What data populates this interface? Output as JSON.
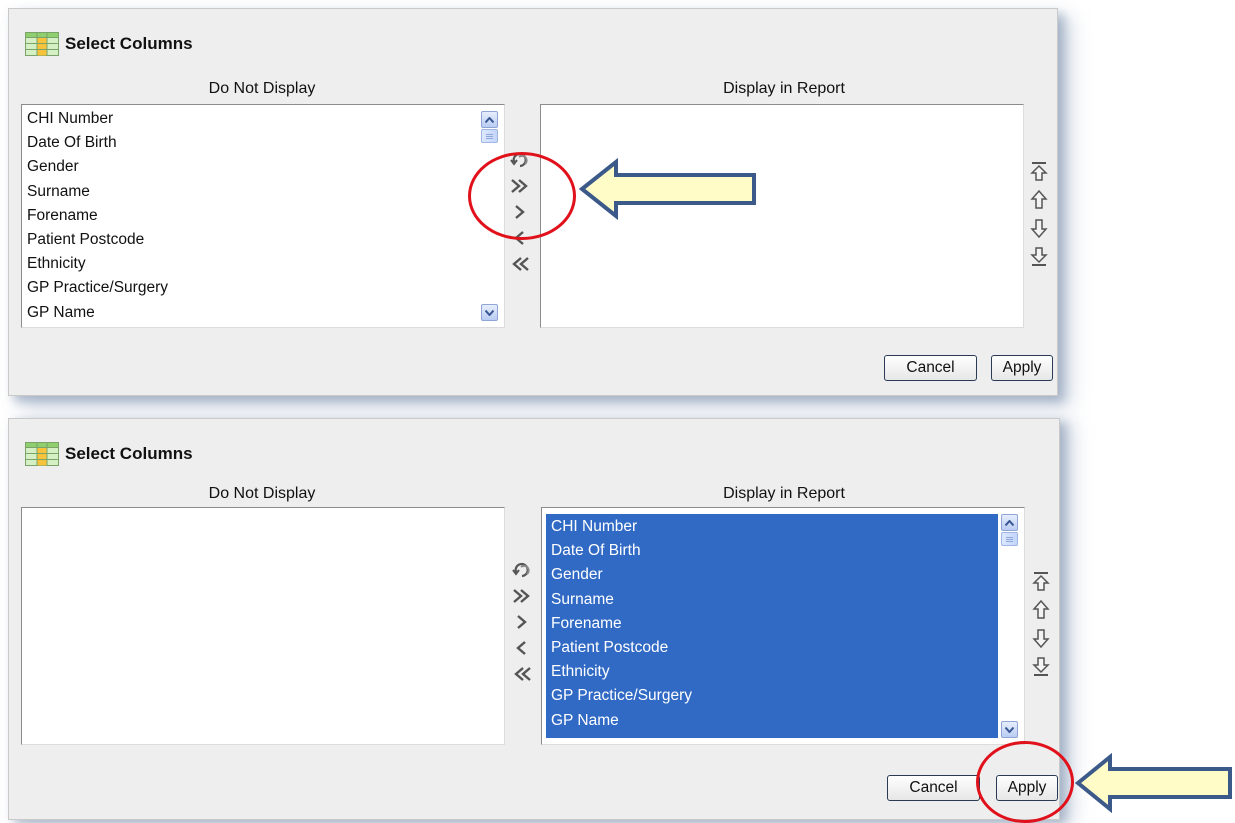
{
  "panels": [
    {
      "title": "Select Columns",
      "left_header": "Do Not Display",
      "right_header": "Display in Report",
      "left_items": [
        "CHI Number",
        "Date Of Birth",
        "Gender",
        "Surname",
        "Forename",
        "Patient Postcode",
        "Ethnicity",
        "GP Practice/Surgery",
        "GP Name"
      ],
      "right_items": [],
      "cancel_label": "Cancel",
      "apply_label": "Apply"
    },
    {
      "title": "Select Columns",
      "left_header": "Do Not Display",
      "right_header": "Display in Report",
      "left_items": [],
      "right_items": [
        "CHI Number",
        "Date Of Birth",
        "Gender",
        "Surname",
        "Forename",
        "Patient Postcode",
        "Ethnicity",
        "GP Practice/Surgery",
        "GP Name"
      ],
      "cancel_label": "Cancel",
      "apply_label": "Apply"
    }
  ],
  "icons": {
    "title": "report-columns-icon",
    "shuttle": [
      "reset-icon",
      "move-all-right-icon",
      "move-right-icon",
      "move-left-icon",
      "move-all-left-icon"
    ],
    "order": [
      "move-top-icon",
      "move-up-icon",
      "move-down-icon",
      "move-bottom-icon"
    ]
  },
  "annotations": {
    "highlight_color": "#e0111b",
    "arrow_fill": "#fffcc8",
    "arrow_stroke": "#3b5a8a"
  },
  "colors": {
    "selection": "#316ac5",
    "panel_bg": "#eeeeee"
  }
}
